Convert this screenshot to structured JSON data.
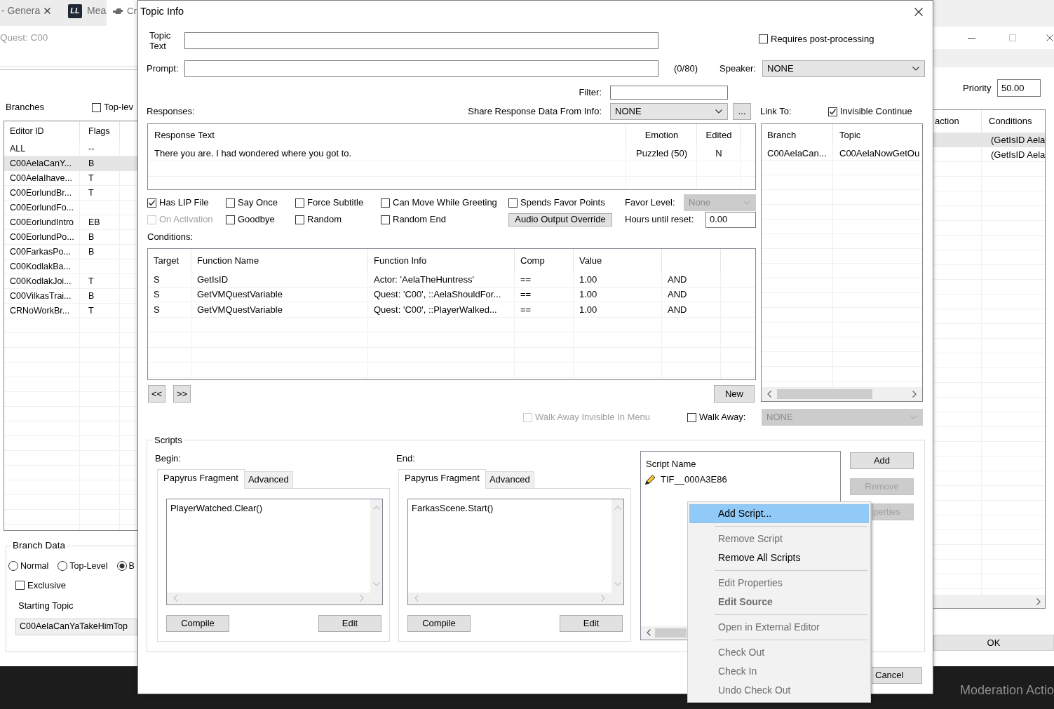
{
  "left_window": {
    "tabs": [
      {
        "label": "- Genera",
        "kind": "closable",
        "selected": false
      },
      {
        "label": "Mea",
        "kind": "logo",
        "logo": "LL",
        "selected": false
      },
      {
        "label": "Cr",
        "kind": "tool",
        "selected": true
      }
    ],
    "quest": "Quest: C00",
    "branches_label": "Branches",
    "top_level": {
      "label": "Top-lev",
      "checked": false
    },
    "branches_table": {
      "columns": [
        "Editor ID",
        "Flags"
      ],
      "rows": [
        {
          "cells": [
            "ALL",
            "--"
          ],
          "selected": false
        },
        {
          "cells": [
            "C00AelaCanY...",
            "B"
          ],
          "selected": true
        },
        {
          "cells": [
            "C00AelaIhave...",
            "T"
          ],
          "selected": false
        },
        {
          "cells": [
            "C00EorlundBr...",
            "T"
          ],
          "selected": false
        },
        {
          "cells": [
            "C00EorlundFo..."
          ],
          "selected": false
        },
        {
          "cells": [
            "C00EorlundIntro",
            "EB"
          ],
          "selected": false
        },
        {
          "cells": [
            "C00EorlundPo...",
            "B"
          ],
          "selected": false
        },
        {
          "cells": [
            "C00FarkasPo...",
            "B"
          ],
          "selected": false
        },
        {
          "cells": [
            "C00KodlakBa..."
          ],
          "selected": false
        },
        {
          "cells": [
            "C00KodlakJoi...",
            "T"
          ],
          "selected": false
        },
        {
          "cells": [
            "C00VilkasTrai...",
            "B"
          ],
          "selected": false
        },
        {
          "cells": [
            "CRNoWorkBr...",
            "T"
          ],
          "selected": false
        }
      ]
    },
    "branch_data": {
      "title": "Branch Data",
      "branch_types": [
        {
          "label": "Normal",
          "selected": false
        },
        {
          "label": "Top-Level",
          "selected": false
        },
        {
          "label": "B",
          "selected": true
        }
      ],
      "exclusive": {
        "label": "Exclusive",
        "checked": false
      },
      "starting_topic_label": "Starting Topic",
      "starting_topic": "C00AelaCanYaTakeHimTop"
    }
  },
  "dialog": {
    "title": "Topic Info",
    "topic_text_label": "Topic Text",
    "requires_post_processing": {
      "label": "Requires post-processing",
      "checked": false
    },
    "prompt_label": "Prompt:",
    "prompt_counter": "(0/80)",
    "speaker": {
      "label": "Speaker:",
      "value": "NONE"
    },
    "filter_label": "Filter:",
    "responses_label": "Responses:",
    "share_response": {
      "label": "Share Response Data From Info:",
      "value": "NONE",
      "browse_button": "..."
    },
    "link_to_label": "Link To:",
    "invisible_continue": {
      "label": "Invisible Continue",
      "checked": true
    },
    "responses_table": {
      "columns": [
        "Response Text",
        "Emotion",
        "Edited"
      ],
      "rows": [
        [
          "There you are. I had wondered where you got to.",
          "Puzzled (50)",
          "N"
        ]
      ]
    },
    "link_table": {
      "columns": [
        "Branch",
        "Topic"
      ],
      "rows": [
        [
          "C00AelaCan...",
          "C00AelaNowGetOu"
        ]
      ]
    },
    "response_options": [
      {
        "label": "Has LIP File",
        "checked": true,
        "disabled": false
      },
      {
        "label": "Say Once",
        "checked": false,
        "disabled": false
      },
      {
        "label": "Force Subtitle",
        "checked": false,
        "disabled": false
      },
      {
        "label": "Can Move While Greeting",
        "checked": false,
        "disabled": false
      },
      {
        "label": "Spends Favor Points",
        "checked": false,
        "disabled": false
      },
      {
        "label": "On Activation",
        "checked": false,
        "disabled": true
      },
      {
        "label": "Goodbye",
        "checked": false,
        "disabled": false
      },
      {
        "label": "Random",
        "checked": false,
        "disabled": false
      },
      {
        "label": "Random End",
        "checked": false,
        "disabled": false
      }
    ],
    "favor_level": {
      "label": "Favor Level:",
      "value": "None",
      "disabled": true
    },
    "audio_output_override": "Audio Output Override",
    "hours_until_reset": {
      "label": "Hours until reset:",
      "value": "0.00"
    },
    "conditions_label": "Conditions:",
    "conditions_table": {
      "columns": [
        "Target",
        "Function Name",
        "Function Info",
        "Comp",
        "Value"
      ],
      "rows": [
        [
          "S",
          "GetIsID",
          "Actor: 'AelaTheHuntress'",
          "==",
          "1.00",
          "AND"
        ],
        [
          "S",
          "GetVMQuestVariable",
          "Quest: 'C00', ::AelaShouldFor...",
          "==",
          "1.00",
          "AND"
        ],
        [
          "S",
          "GetVMQuestVariable",
          "Quest: 'C00', ::PlayerWalked...",
          "==",
          "1.00",
          "AND"
        ]
      ]
    },
    "nav_buttons": [
      "<<",
      ">>"
    ],
    "new_button": "New",
    "walk_away_invisible": {
      "label": "Walk Away Invisible In Menu",
      "checked": false,
      "disabled": true
    },
    "walk_away": {
      "label": "Walk Away:",
      "checked": false
    },
    "walk_away_topic": {
      "value": "NONE",
      "disabled": true
    },
    "scripts": {
      "title": "Scripts",
      "fragments": [
        {
          "label": "Begin:",
          "tabs": [
            {
              "label": "Papyrus Fragment",
              "selected": true
            },
            {
              "label": "Advanced",
              "selected": false
            }
          ],
          "code": "PlayerWatched.Clear()",
          "compile_button": "Compile",
          "edit_button": "Edit"
        },
        {
          "label": "End:",
          "tabs": [
            {
              "label": "Papyrus Fragment",
              "selected": true
            },
            {
              "label": "Advanced",
              "selected": false
            }
          ],
          "code": "FarkasScene.Start()",
          "compile_button": "Compile",
          "edit_button": "Edit"
        }
      ],
      "list_header": "Script Name",
      "scripts": [
        "TIF__000A3E86"
      ],
      "buttons": [
        {
          "label": "Add",
          "disabled": false
        },
        {
          "label": "Remove",
          "disabled": true
        },
        {
          "label": "perties",
          "disabled": true
        }
      ]
    },
    "cancel_button": "Cancel"
  },
  "right_window": {
    "priority_label": "Priority",
    "priority": "50.00",
    "table": {
      "columns": [
        "action",
        "Conditions"
      ],
      "rows": [
        {
          "conditions": "(GetIsID Aela",
          "selected": true
        },
        {
          "conditions": "(GetIsID Aela",
          "selected": false
        }
      ]
    },
    "ok": "OK"
  },
  "context_menu": {
    "groups": [
      [
        {
          "label": "Add Script...",
          "selected": true,
          "disabled": false,
          "default": false
        }
      ],
      [
        {
          "label": "Remove Script",
          "selected": false,
          "disabled": true,
          "default": false
        },
        {
          "label": "Remove All Scripts",
          "selected": false,
          "disabled": false,
          "default": false
        }
      ],
      [
        {
          "label": "Edit Properties",
          "selected": false,
          "disabled": true,
          "default": false
        },
        {
          "label": "Edit Source",
          "selected": false,
          "disabled": true,
          "default": true
        }
      ],
      [
        {
          "label": "Open in External Editor",
          "selected": false,
          "disabled": true,
          "default": false
        }
      ],
      [
        {
          "label": "Check Out",
          "selected": false,
          "disabled": true,
          "default": false
        },
        {
          "label": "Check In",
          "selected": false,
          "disabled": true,
          "default": false
        },
        {
          "label": "Undo Check Out",
          "selected": false,
          "disabled": true,
          "default": false
        }
      ]
    ]
  },
  "bottom_bar": {
    "label": "Moderation Actio"
  }
}
